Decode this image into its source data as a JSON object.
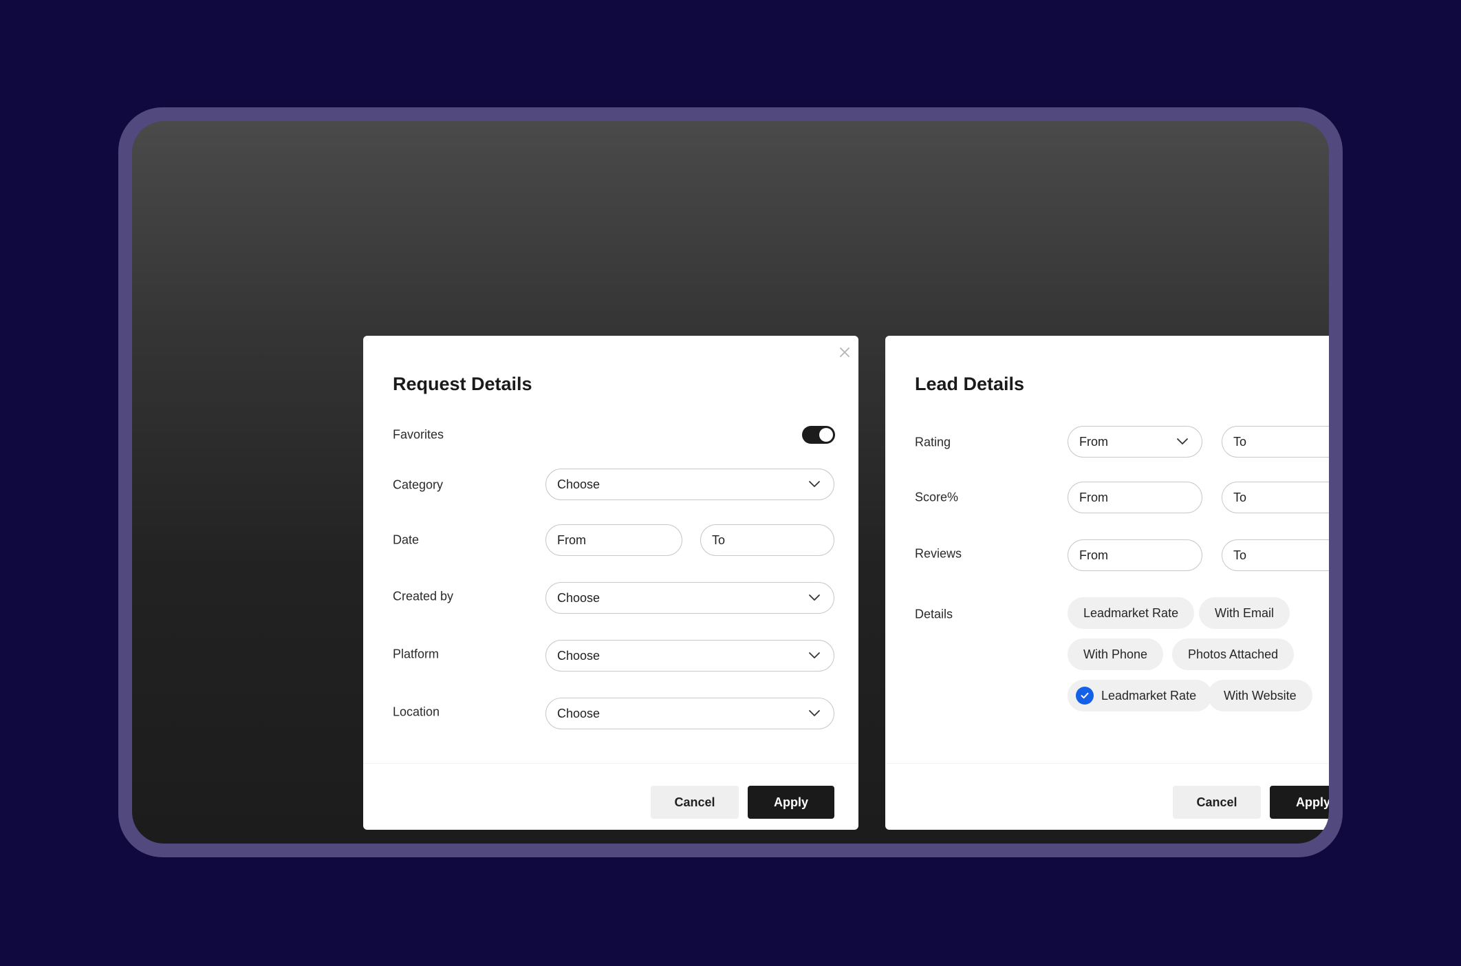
{
  "request_details": {
    "title": "Request Details",
    "favorites": {
      "label": "Favorites",
      "enabled": true
    },
    "category": {
      "label": "Category",
      "value": "Choose"
    },
    "date": {
      "label": "Date",
      "from": "From",
      "to": "To"
    },
    "created_by": {
      "label": "Created by",
      "value": "Choose"
    },
    "platform": {
      "label": "Platform",
      "value": "Choose"
    },
    "location": {
      "label": "Location",
      "value": "Choose"
    },
    "cancel_label": "Cancel",
    "apply_label": "Apply"
  },
  "lead_details": {
    "title": "Lead Details",
    "rating": {
      "label": "Rating",
      "from": "From",
      "to": "To"
    },
    "score": {
      "label": "Score%",
      "from": "From",
      "to": "To"
    },
    "reviews": {
      "label": "Reviews",
      "from": "From",
      "to": "To"
    },
    "details": {
      "label": "Details",
      "chips": [
        {
          "label": "Leadmarket Rate",
          "checked": false
        },
        {
          "label": "With Email",
          "checked": false
        },
        {
          "label": "With Phone",
          "checked": false
        },
        {
          "label": "Photos Attached",
          "checked": false
        },
        {
          "label": "Leadmarket Rate",
          "checked": true
        },
        {
          "label": "With Website",
          "checked": false
        }
      ]
    },
    "cancel_label": "Cancel",
    "apply_label": "Apply"
  },
  "colors": {
    "page_background": "#0f0940",
    "frame": "#52497f",
    "accent_check": "#1560e8",
    "apply_button": "#1a1a1a"
  },
  "icons": [
    "close-icon",
    "chevron-down-icon",
    "check-icon"
  ]
}
